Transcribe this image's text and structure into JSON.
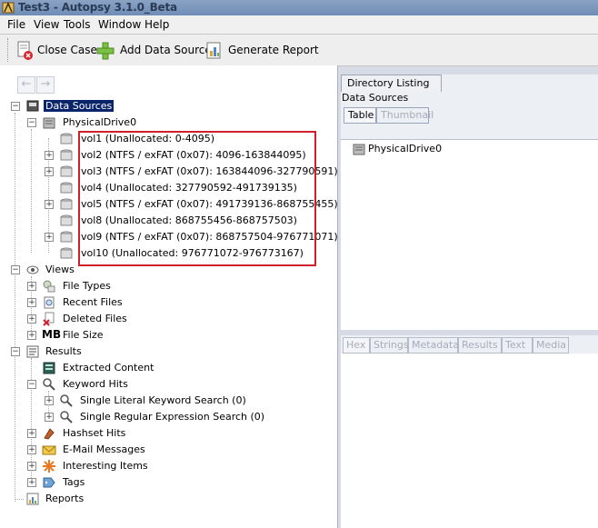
{
  "window": {
    "title": "Test3 - Autopsy 3.1.0_Beta"
  },
  "menu": [
    "File",
    "View",
    "Tools",
    "Window",
    "Help"
  ],
  "toolbar": {
    "close_case": "Close Case",
    "add_data_source": "Add Data Source",
    "generate_report": "Generate Report"
  },
  "nav": {
    "back": "←",
    "forward": "→"
  },
  "tree": {
    "data_sources": "Data Sources",
    "drive": "PhysicalDrive0",
    "volumes": [
      "vol1 (Unallocated: 0-4095)",
      "vol2 (NTFS / exFAT (0x07): 4096-163844095)",
      "vol3 (NTFS / exFAT (0x07): 163844096-327790591)",
      "vol4 (Unallocated: 327790592-491739135)",
      "vol5 (NTFS / exFAT (0x07): 491739136-868755455)",
      "vol8 (Unallocated: 868755456-868757503)",
      "vol9 (NTFS / exFAT (0x07): 868757504-976771071)",
      "vol10 (Unallocated: 976771072-976773167)"
    ],
    "views": "Views",
    "file_types": "File Types",
    "recent_files": "Recent Files",
    "deleted_files": "Deleted Files",
    "file_size": "File Size",
    "file_size_icon_text": "MB",
    "results": "Results",
    "extracted_content": "Extracted Content",
    "keyword_hits": "Keyword Hits",
    "literal_search": "Single Literal Keyword Search (0)",
    "regex_search": "Single Regular Expression Search (0)",
    "hashset_hits": "Hashset Hits",
    "email_messages": "E-Mail Messages",
    "interesting_items": "Interesting Items",
    "tags": "Tags",
    "reports": "Reports"
  },
  "directory": {
    "tab": "Directory Listing",
    "label": "Data Sources",
    "subtabs": [
      "Table",
      "Thumbnail"
    ],
    "rows": [
      "PhysicalDrive0"
    ]
  },
  "content_tabs": [
    "Hex",
    "Strings",
    "Metadata",
    "Results",
    "Text",
    "Media"
  ],
  "colors": {
    "highlight": "#0a246a",
    "annotation_box": "#d0202a",
    "pane_bg": "#d6dbe6"
  }
}
